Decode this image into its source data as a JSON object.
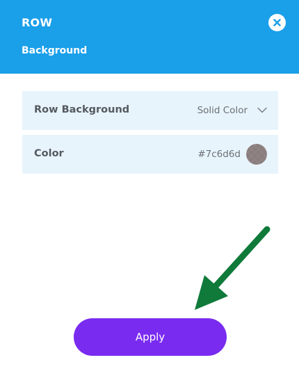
{
  "header": {
    "title": "ROW",
    "subtitle": "Background"
  },
  "fields": {
    "row_background": {
      "label": "Row Background",
      "value": "Solid Color"
    },
    "color": {
      "label": "Color",
      "value": "#7c6d6d"
    }
  },
  "actions": {
    "apply_label": "Apply"
  },
  "icons": {
    "close": "close-icon",
    "chevron": "chevron-down-icon",
    "arrow": "arrow-down-left-icon"
  },
  "colors": {
    "header_bg": "#1a9fe9",
    "row_bg": "#e8f4fc",
    "apply_bg": "#7a2bf0",
    "arrow": "#0f7a3a",
    "swatch": "#7c6d6d"
  }
}
